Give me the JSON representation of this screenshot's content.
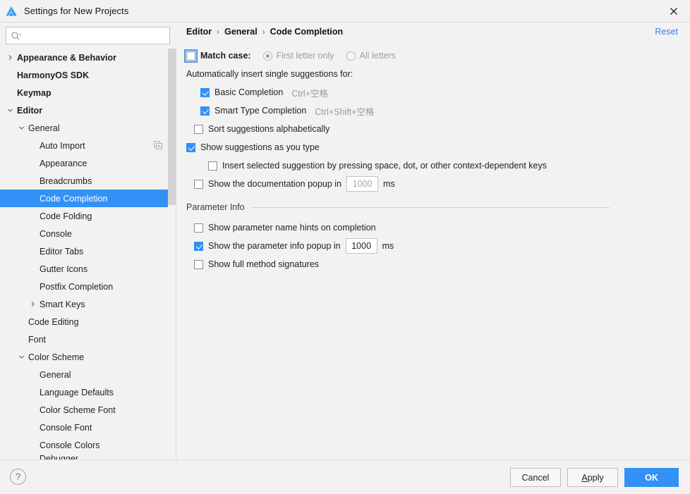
{
  "window": {
    "title": "Settings for New Projects",
    "logo_icon": "deveco-studio-logo",
    "close_icon": "close-icon"
  },
  "search": {
    "value": "",
    "placeholder": "",
    "icon": "search-icon"
  },
  "sidebar": {
    "scrollbar": "vertical-scrollbar",
    "items": [
      {
        "label": "Appearance & Behavior",
        "depth": 0,
        "bold": true,
        "arrow": "chevron-right-icon",
        "selected": false
      },
      {
        "label": "HarmonyOS SDK",
        "depth": 0,
        "bold": true,
        "arrow": "none",
        "selected": false
      },
      {
        "label": "Keymap",
        "depth": 0,
        "bold": true,
        "arrow": "none",
        "selected": false
      },
      {
        "label": "Editor",
        "depth": 0,
        "bold": true,
        "arrow": "chevron-down-icon",
        "selected": false
      },
      {
        "label": "General",
        "depth": 1,
        "bold": false,
        "arrow": "chevron-down-icon",
        "selected": false
      },
      {
        "label": "Auto Import",
        "depth": 2,
        "bold": false,
        "arrow": "none",
        "selected": false,
        "badge": "copy-icon"
      },
      {
        "label": "Appearance",
        "depth": 2,
        "bold": false,
        "arrow": "none",
        "selected": false
      },
      {
        "label": "Breadcrumbs",
        "depth": 2,
        "bold": false,
        "arrow": "none",
        "selected": false
      },
      {
        "label": "Code Completion",
        "depth": 2,
        "bold": false,
        "arrow": "none",
        "selected": true
      },
      {
        "label": "Code Folding",
        "depth": 2,
        "bold": false,
        "arrow": "none",
        "selected": false
      },
      {
        "label": "Console",
        "depth": 2,
        "bold": false,
        "arrow": "none",
        "selected": false
      },
      {
        "label": "Editor Tabs",
        "depth": 2,
        "bold": false,
        "arrow": "none",
        "selected": false
      },
      {
        "label": "Gutter Icons",
        "depth": 2,
        "bold": false,
        "arrow": "none",
        "selected": false
      },
      {
        "label": "Postfix Completion",
        "depth": 2,
        "bold": false,
        "arrow": "none",
        "selected": false
      },
      {
        "label": "Smart Keys",
        "depth": 2,
        "bold": false,
        "arrow": "chevron-right-icon",
        "selected": false
      },
      {
        "label": "Code Editing",
        "depth": 1,
        "bold": false,
        "arrow": "none",
        "selected": false
      },
      {
        "label": "Font",
        "depth": 1,
        "bold": false,
        "arrow": "none",
        "selected": false
      },
      {
        "label": "Color Scheme",
        "depth": 1,
        "bold": false,
        "arrow": "chevron-down-icon",
        "selected": false
      },
      {
        "label": "General",
        "depth": 2,
        "bold": false,
        "arrow": "none",
        "selected": false
      },
      {
        "label": "Language Defaults",
        "depth": 2,
        "bold": false,
        "arrow": "none",
        "selected": false
      },
      {
        "label": "Color Scheme Font",
        "depth": 2,
        "bold": false,
        "arrow": "none",
        "selected": false
      },
      {
        "label": "Console Font",
        "depth": 2,
        "bold": false,
        "arrow": "none",
        "selected": false
      },
      {
        "label": "Console Colors",
        "depth": 2,
        "bold": false,
        "arrow": "none",
        "selected": false
      },
      {
        "label": "Debugger",
        "depth": 2,
        "bold": false,
        "arrow": "none",
        "selected": false,
        "clipped": true
      }
    ]
  },
  "content": {
    "breadcrumb": {
      "items": [
        "Editor",
        "General",
        "Code Completion"
      ],
      "separator": "›"
    },
    "reset_label": "Reset",
    "match_case": {
      "label": "Match case:",
      "checked": false,
      "focused": true,
      "options": [
        {
          "label": "First letter only",
          "selected": true,
          "disabled": true
        },
        {
          "label": "All letters",
          "selected": false,
          "disabled": true
        }
      ]
    },
    "auto_insert_header": "Automatically insert single suggestions for:",
    "auto_insert_items": [
      {
        "label": "Basic Completion",
        "shortcut": "Ctrl+空格",
        "checked": true
      },
      {
        "label": "Smart Type Completion",
        "shortcut": "Ctrl+Shift+空格",
        "checked": true
      }
    ],
    "sort_alphabetically": {
      "label": "Sort suggestions alphabetically",
      "checked": false
    },
    "show_as_you_type": {
      "label": "Show suggestions as you type",
      "checked": true
    },
    "insert_selected": {
      "label": "Insert selected suggestion by pressing space, dot, or other context-dependent keys",
      "checked": false
    },
    "documentation_popup": {
      "label_before": "Show the documentation popup in",
      "value": "1000",
      "units": "ms",
      "checked": false,
      "disabled": true
    },
    "parameter_info": {
      "section_title": "Parameter Info",
      "name_hints": {
        "label": "Show parameter name hints on completion",
        "checked": false
      },
      "popup_delay": {
        "label_before": "Show the parameter info popup in",
        "value": "1000",
        "units": "ms",
        "checked": true,
        "disabled": false
      },
      "full_signatures": {
        "label": "Show full method signatures",
        "checked": false
      }
    }
  },
  "footer": {
    "help_icon": "question-mark-icon",
    "help_glyph": "?",
    "cancel_label": "Cancel",
    "apply_label_prefix": "A",
    "apply_label_rest": "pply",
    "ok_label": "OK"
  },
  "colors": {
    "accent": "#3391f5",
    "link": "#3a7ddc",
    "window_bg": "#f2f2f2",
    "disabled_text": "#9f9f9f"
  }
}
